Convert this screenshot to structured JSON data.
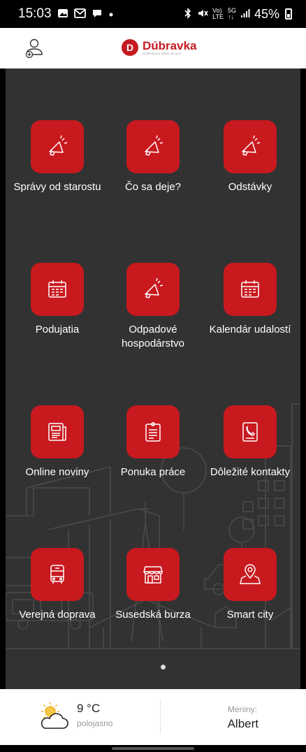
{
  "status_bar": {
    "time": "15:03",
    "battery": "45%",
    "icons": [
      "gallery-icon",
      "gmail-icon",
      "chat-icon",
      "dot-icon",
      "bluetooth-icon",
      "mute-icon",
      "volte-icon",
      "5g-icon",
      "signal-icon",
      "battery-icon"
    ],
    "volte_top": "Vo)",
    "volte_bottom": "LTE",
    "net_top": "5G",
    "net_bottom": "↑↓"
  },
  "header": {
    "logo_name": "Dúbravka",
    "logo_sub": "DÚBRAVKA BRATISLAVA",
    "logo_mark": "D",
    "left_icon": "user-add-icon"
  },
  "tiles": [
    {
      "label": "Správy od starostu",
      "icon": "megaphone-icon"
    },
    {
      "label": "Čo sa deje?",
      "icon": "megaphone-icon"
    },
    {
      "label": "Odstávky",
      "icon": "megaphone-icon"
    },
    {
      "label": "Podujatia",
      "icon": "calendar-icon"
    },
    {
      "label": "Odpadové hospodárstvo",
      "icon": "megaphone-icon"
    },
    {
      "label": "Kalendár udalostí",
      "icon": "calendar-icon"
    },
    {
      "label": "Online noviny",
      "icon": "newspaper-icon"
    },
    {
      "label": "Ponuka práce",
      "icon": "clipboard-icon"
    },
    {
      "label": "Dôležité kontakty",
      "icon": "phone-card-icon"
    },
    {
      "label": "Verejná doprava",
      "icon": "bus-icon"
    },
    {
      "label": "Susedská burza",
      "icon": "shop-icon"
    },
    {
      "label": "Smart city",
      "icon": "map-pin-icon"
    }
  ],
  "pagination": {
    "current": 1,
    "total": 1
  },
  "weather": {
    "temp": "9 °C",
    "condition": "polojasno",
    "icon": "partly-cloudy-icon"
  },
  "nameday": {
    "label": "Meniny:",
    "name": "Albert"
  },
  "colors": {
    "accent": "#c8191f",
    "background": "#323232",
    "header": "#ffffff"
  }
}
